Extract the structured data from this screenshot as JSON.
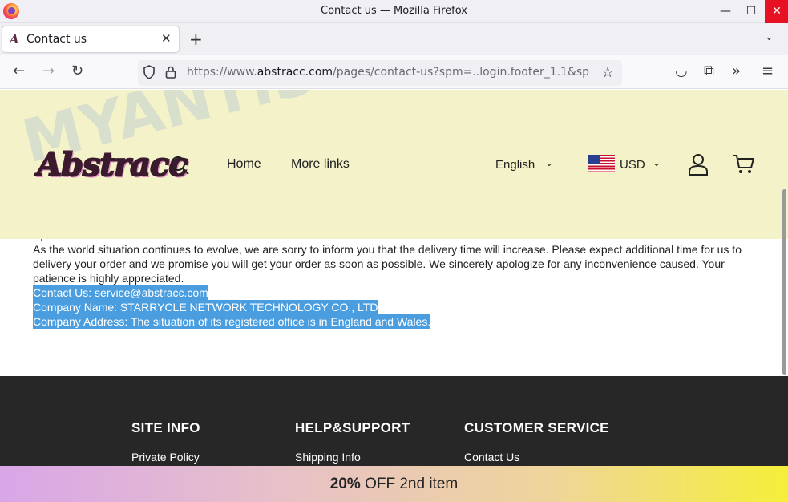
{
  "window": {
    "title": "Contact us — Mozilla Firefox",
    "controls": {
      "minimize": "—",
      "maximize": "☐",
      "close": "✕"
    }
  },
  "tabs": [
    {
      "label": "Contact us",
      "close": "✕"
    }
  ],
  "tabstrip": {
    "new_tab": "+",
    "list_all": "⌄"
  },
  "navbar": {
    "back": "←",
    "forward": "→",
    "reload": "↻",
    "url_prefix": "https://www.",
    "url_domain": "abstracc.com",
    "url_suffix": "/pages/contact-us?spm=..login.footer_1.1&sp",
    "bookmark": "☆",
    "pocket": "◡",
    "extensions": "⧉",
    "overflow": "»",
    "menu": "≡"
  },
  "site": {
    "logo": "Abstracc",
    "nav": {
      "home": "Home",
      "more": "More links"
    },
    "language": "English",
    "currency": "USD",
    "chevron": "⌄"
  },
  "content": {
    "special_note": "Special Note:",
    "paragraph": "As the world situation continues to evolve, we are sorry to inform you that the delivery time will increase. Please expect additional time for us to delivery your order and we promise you will get your order as soon as possible. We sincerely apologize for any inconvenience caused. Your patience is highly appreciated.",
    "contact": "Contact Us:  service@abstracc.com",
    "company_name": "Company Name: STARRYCLE NETWORK TECHNOLOGY CO., LTD",
    "company_address": "Company Address: The situation of its registered office is in England and Wales."
  },
  "footer": {
    "columns": [
      {
        "heading": "SITE INFO",
        "link": "Private Policy"
      },
      {
        "heading": "HELP&SUPPORT",
        "link": "Shipping Info"
      },
      {
        "heading": "CUSTOMER SERVICE",
        "link": "Contact Us"
      }
    ]
  },
  "promo": {
    "bold": "20%",
    "rest": " OFF 2nd item"
  },
  "watermark": "MYANTISPYWARE.COM",
  "colors": {
    "header_bg": "#f3f2c8",
    "highlight": "#4a9ee0",
    "footer_bg": "#272727",
    "close_red": "#e81123"
  }
}
